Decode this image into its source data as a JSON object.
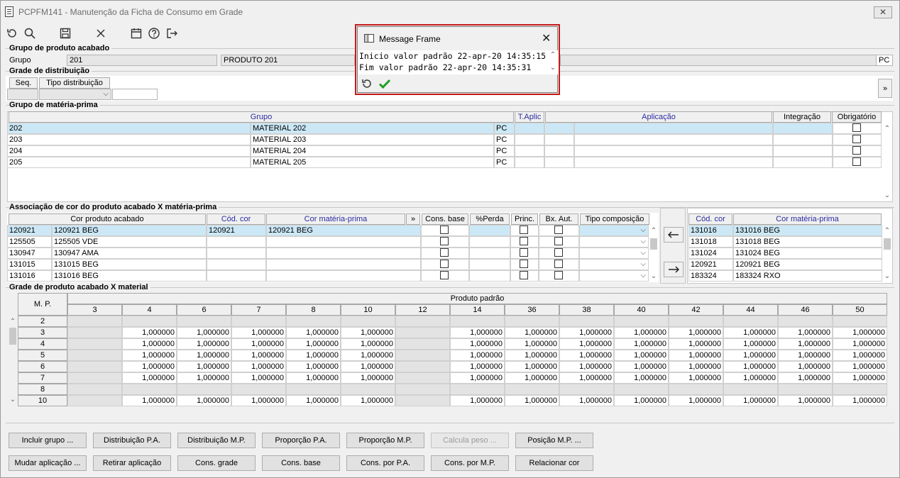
{
  "window": {
    "title": "PCPFM141 - Manutenção da Ficha de Consumo em Grade",
    "close_glyph": "✕"
  },
  "toolbar": {
    "icons": [
      "refresh-icon",
      "search-icon",
      "save-icon",
      "cancel-icon",
      "calendar-icon",
      "help-icon",
      "exit-icon"
    ]
  },
  "produto_acabado": {
    "section_label": "Grupo de produto acabado",
    "grupo_label": "Grupo",
    "grupo_value": "201",
    "descricao_value": "PRODUTO 201",
    "unidade_value": "PC"
  },
  "grade_distribuicao": {
    "section_label": "Grade de distribuição",
    "col_seq": "Seq.",
    "col_tipo": "Tipo distribuição",
    "expand_label": "»"
  },
  "materia_prima": {
    "section_label": "Grupo de matéria-prima",
    "headers": {
      "grupo": "Grupo",
      "t_aplic": "T.Aplic",
      "aplicacao": "Aplicação",
      "integracao": "Integração",
      "obrigatorio": "Obrigatório"
    },
    "rows": [
      {
        "codigo": "202",
        "nome": "MATERIAL 202",
        "un": "PC"
      },
      {
        "codigo": "203",
        "nome": "MATERIAL 203",
        "un": "PC"
      },
      {
        "codigo": "204",
        "nome": "MATERIAL 204",
        "un": "PC"
      },
      {
        "codigo": "205",
        "nome": "MATERIAL 205",
        "un": "PC"
      }
    ]
  },
  "associacao": {
    "section_label": "Associação de cor do produto acabado X matéria-prima",
    "headers": {
      "cor_produto": "Cor produto acabado",
      "cod_cor": "Cód. cor",
      "cor_materia": "Cor matéria-prima",
      "expand": "»",
      "cons_base": "Cons. base",
      "perda": "%Perda",
      "princ": "Princ.",
      "bx_aut": "Bx. Aut.",
      "tipo_composicao": "Tipo composição"
    },
    "rows": [
      {
        "cod": "120921",
        "desc": "120921 BEG",
        "cod_cor": "120921",
        "cor_mp": "120921 BEG"
      },
      {
        "cod": "125505",
        "desc": "125505 VDE",
        "cod_cor": "",
        "cor_mp": ""
      },
      {
        "cod": "130947",
        "desc": "130947 AMA",
        "cod_cor": "",
        "cor_mp": ""
      },
      {
        "cod": "131015",
        "desc": "131015 BEG",
        "cod_cor": "",
        "cor_mp": ""
      },
      {
        "cod": "131016",
        "desc": "131016 BEG",
        "cod_cor": "",
        "cor_mp": ""
      }
    ],
    "right_headers": {
      "cod_cor": "Cód. cor",
      "cor_materia": "Cor matéria-prima"
    },
    "right_rows": [
      {
        "cod": "131016",
        "desc": "131016 BEG"
      },
      {
        "cod": "131018",
        "desc": "131018 BEG"
      },
      {
        "cod": "131024",
        "desc": "131024 BEG"
      },
      {
        "cod": "120921",
        "desc": "120921 BEG"
      },
      {
        "cod": "183324",
        "desc": "183324 RXO"
      }
    ]
  },
  "grade_material": {
    "section_label": "Grade de produto acabado X material",
    "row_header": "M. P.",
    "group_header": "Produto padrão",
    "sizes": [
      "3",
      "4",
      "6",
      "7",
      "8",
      "10",
      "12",
      "14",
      "36",
      "38",
      "40",
      "42",
      "44",
      "46",
      "50"
    ],
    "rows": [
      "2",
      "3",
      "4",
      "5",
      "6",
      "7",
      "8",
      "10"
    ],
    "filled_rows": [
      "3",
      "4",
      "5",
      "6",
      "7",
      "10"
    ],
    "empty_cols": [
      "3",
      "12"
    ],
    "value": "1,000000"
  },
  "buttons_row1": [
    {
      "label": "Incluir grupo ...",
      "enabled": true
    },
    {
      "label": "Distribuição P.A.",
      "enabled": true
    },
    {
      "label": "Distribuição M.P.",
      "enabled": true
    },
    {
      "label": "Proporção P.A.",
      "enabled": true
    },
    {
      "label": "Proporção M.P.",
      "enabled": true
    },
    {
      "label": "Calcula peso ...",
      "enabled": false
    },
    {
      "label": "Posição M.P. ...",
      "enabled": true
    }
  ],
  "buttons_row2": [
    {
      "label": "Mudar aplicação ...",
      "enabled": true
    },
    {
      "label": "Retirar aplicação",
      "enabled": true
    },
    {
      "label": "Cons. grade",
      "enabled": true
    },
    {
      "label": "Cons. base",
      "enabled": true
    },
    {
      "label": "Cons. por P.A.",
      "enabled": true
    },
    {
      "label": "Cons. por M.P.",
      "enabled": true
    },
    {
      "label": "Relacionar cor",
      "enabled": true
    }
  ],
  "message_frame": {
    "title": "Message Frame",
    "close_glyph": "✕",
    "lines": [
      "Inicio valor padrão 22-apr-20 14:35:15",
      "Fim valor padrão 22-apr-20 14:35:31"
    ],
    "accent_color": "#c41a1a",
    "confirm_color": "#1f9e1f"
  }
}
